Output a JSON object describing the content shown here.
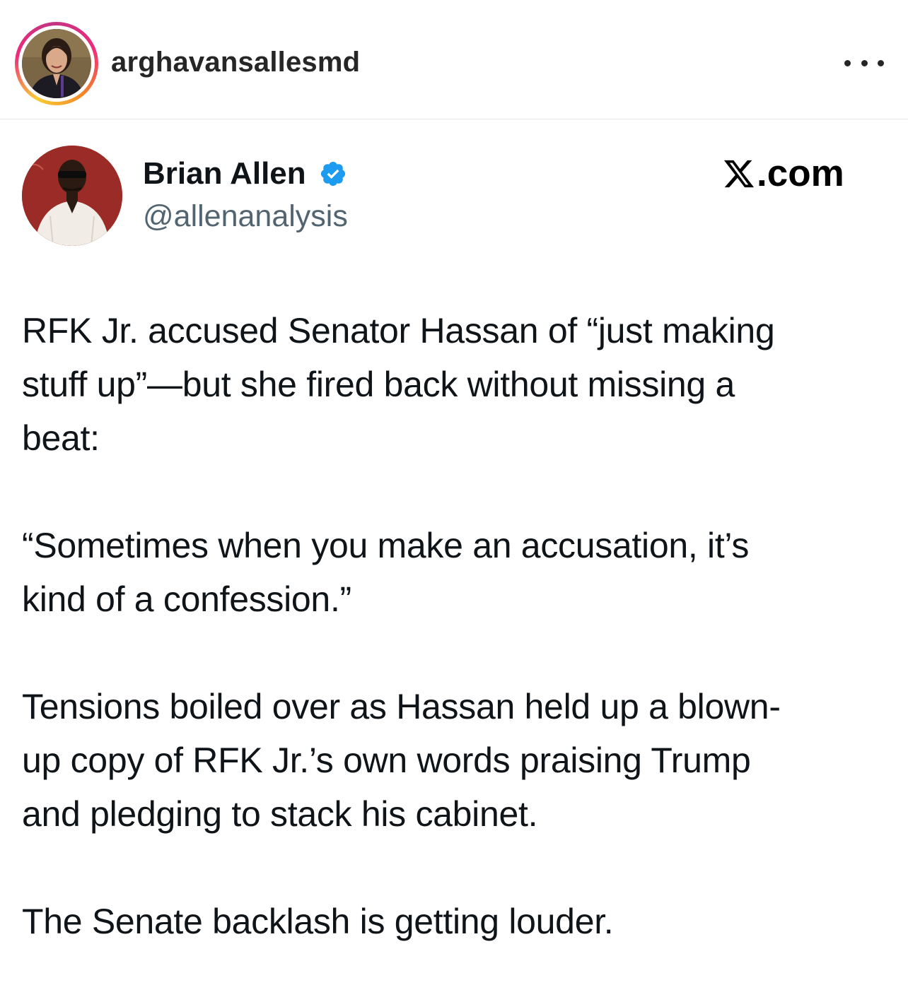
{
  "instagram_post": {
    "username": "arghavansallesmd",
    "more_icon": "more-horizontal-icon",
    "story_ring_colors": [
      "#f9ce34",
      "#ee2a7b",
      "#c13584",
      "#f58529"
    ]
  },
  "tweet": {
    "author_name": "Brian Allen",
    "verified_icon": "verified-badge-icon",
    "verified_color": "#1d9bf0",
    "handle": "@allenanalysis",
    "source_label": ".com",
    "source_icon": "x-logo-icon",
    "paragraphs": [
      "RFK Jr. accused Senator Hassan of “just making\nstuff up”—but she fired back without missing a\nbeat:",
      "“Sometimes when you make an accusation, it’s\nkind of a confession.”",
      "Tensions boiled over as Hassan held up a blown-\nup copy of RFK Jr.’s own words praising Trump\nand pledging to stack his cabinet.",
      "The Senate backlash is getting louder."
    ]
  }
}
